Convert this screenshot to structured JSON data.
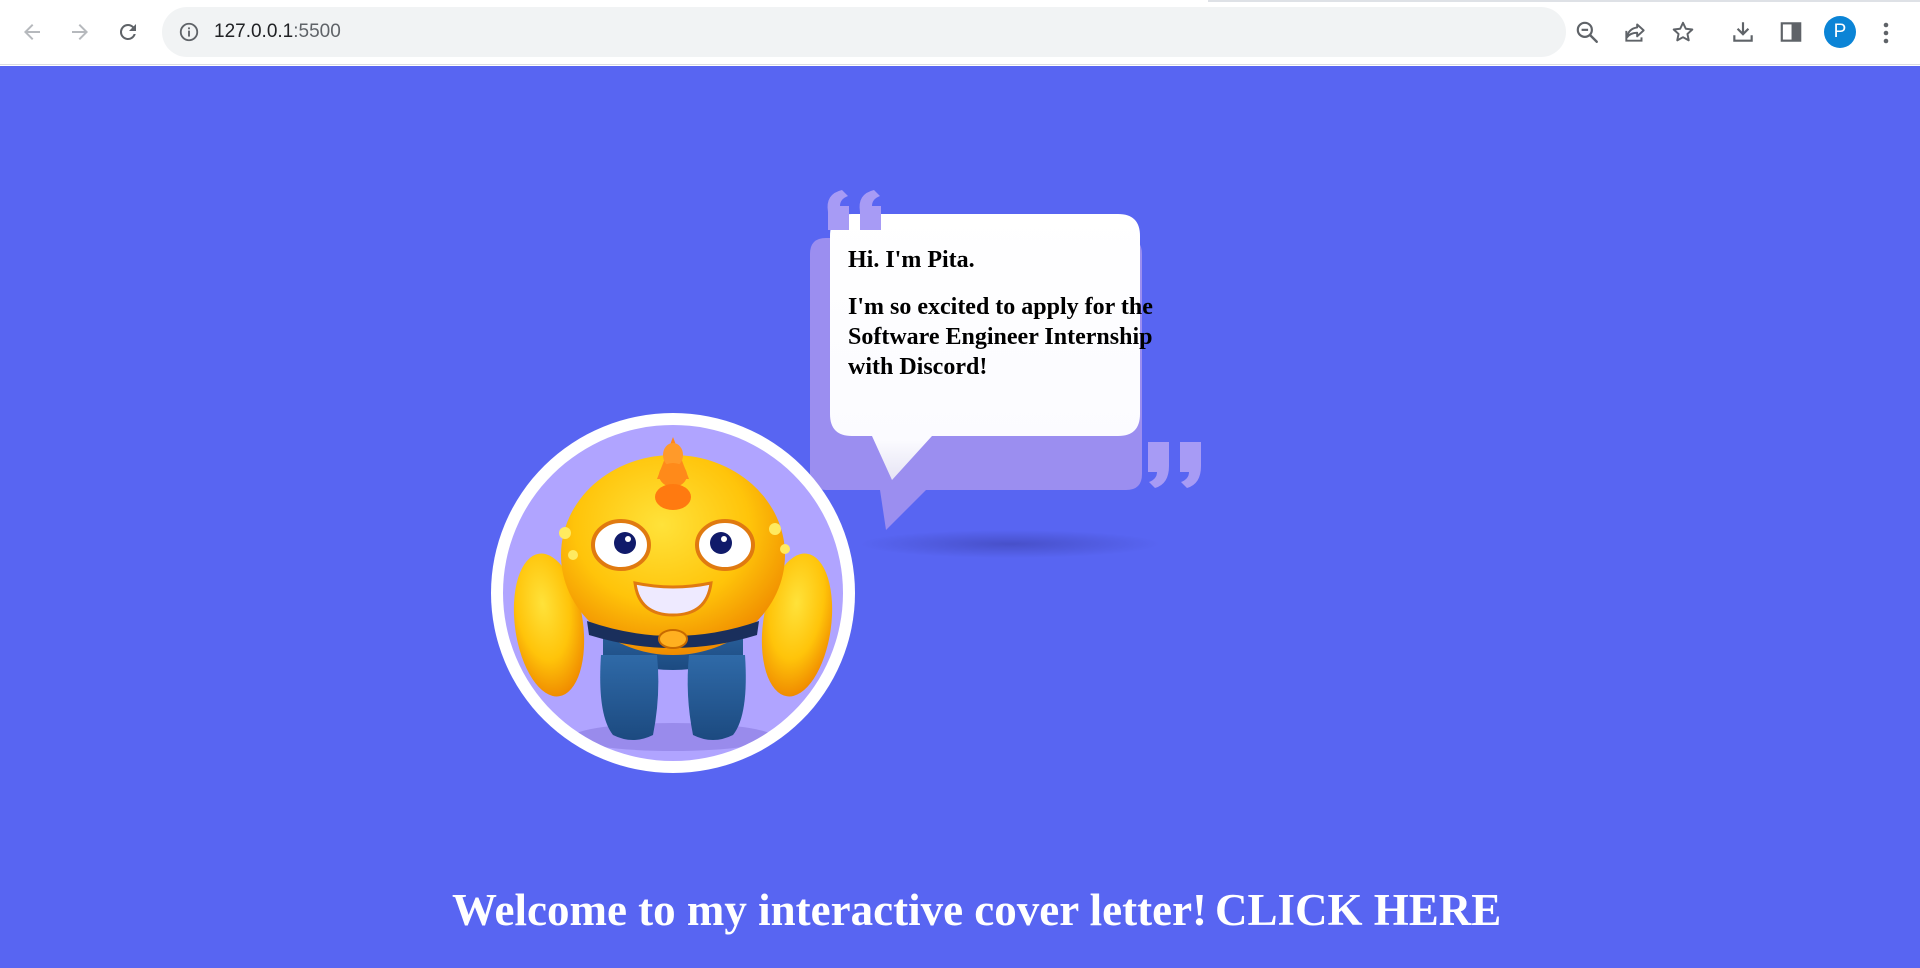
{
  "browser": {
    "url_host": "127.0.0.1",
    "url_port": ":5500",
    "avatar_initial": "P",
    "icons": {
      "back": "back-arrow-icon",
      "forward": "forward-arrow-icon",
      "reload": "reload-icon",
      "site_info": "info-icon",
      "zoom": "zoom-out-icon",
      "share": "share-icon",
      "bookmark": "star-icon",
      "downloads": "download-icon",
      "side_panel": "side-panel-icon",
      "menu": "kebab-menu-icon"
    }
  },
  "page": {
    "background_color": "#5865f2",
    "bubble": {
      "greeting": "Hi. I'm Pita.",
      "message": "I'm so excited to apply for the Software Engineer Internship with Discord!"
    },
    "welcome_text": "Welcome to my interactive cover letter!",
    "cta_label": "CLICK HERE"
  }
}
